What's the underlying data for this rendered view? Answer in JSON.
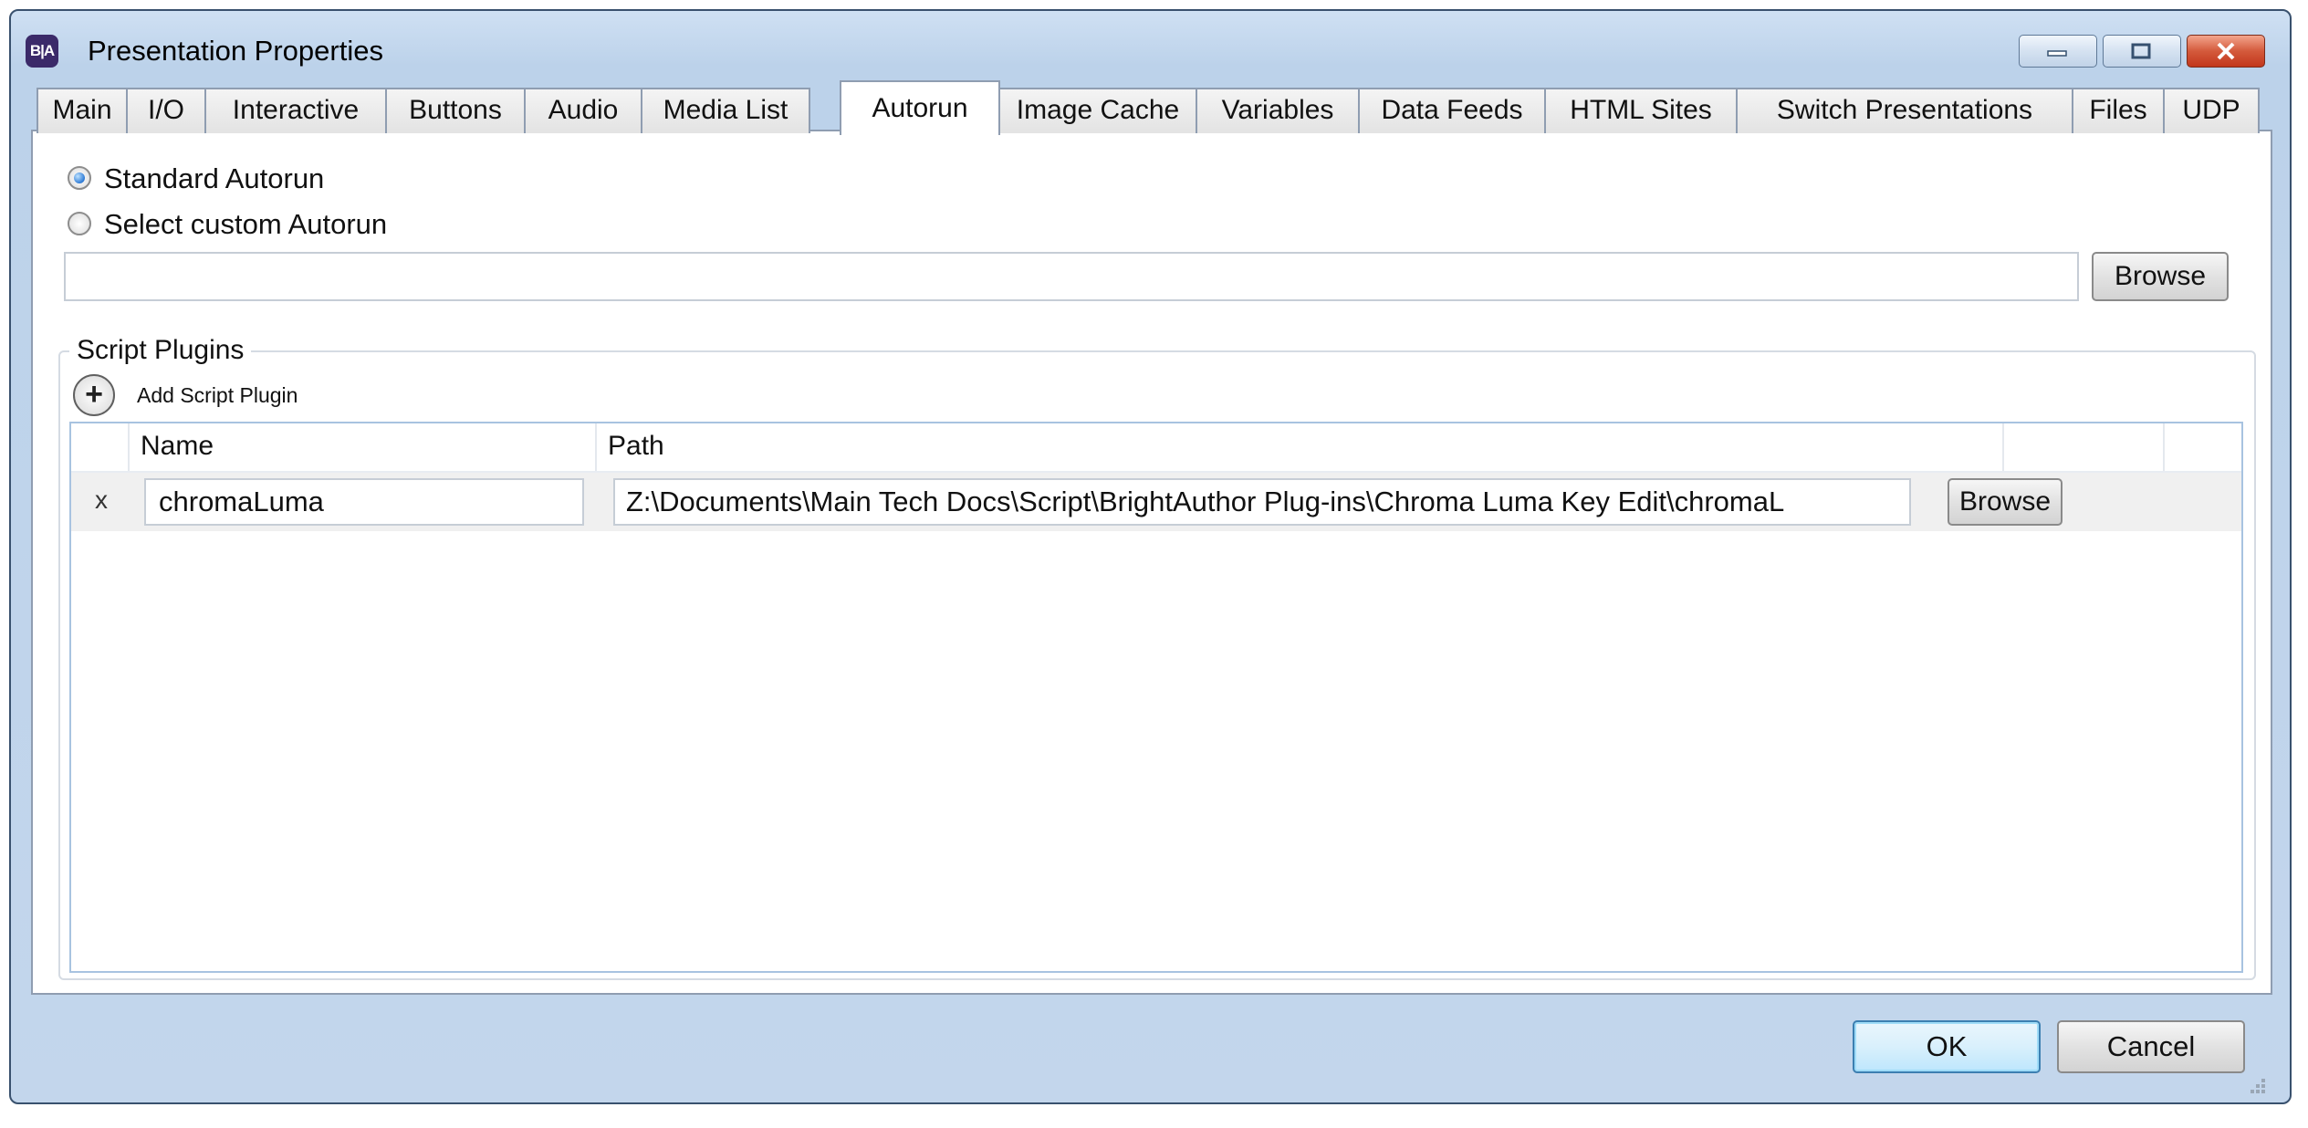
{
  "window": {
    "title": "Presentation Properties",
    "app_icon_text": "B|A"
  },
  "tabs": [
    {
      "label": "Main"
    },
    {
      "label": "I/O"
    },
    {
      "label": "Interactive"
    },
    {
      "label": "Buttons"
    },
    {
      "label": "Audio"
    },
    {
      "label": "Media List"
    },
    {
      "label": "Autorun",
      "selected": true
    },
    {
      "label": "Image Cache"
    },
    {
      "label": "Variables"
    },
    {
      "label": "Data Feeds"
    },
    {
      "label": "HTML Sites"
    },
    {
      "label": "Switch Presentations"
    },
    {
      "label": "Files"
    },
    {
      "label": "UDP"
    }
  ],
  "autorun": {
    "standard_label": "Standard Autorun",
    "standard_selected": true,
    "custom_label": "Select custom Autorun",
    "custom_selected": false,
    "custom_path_value": "",
    "browse_label": "Browse"
  },
  "script_plugins": {
    "group_title": "Script Plugins",
    "add_label": "Add Script Plugin",
    "columns": [
      "Name",
      "Path"
    ],
    "rows": [
      {
        "delete_label": "x",
        "name": "chromaLuma",
        "path": "Z:\\Documents\\Main Tech Docs\\Script\\BrightAuthor Plug-ins\\Chroma Luma Key Edit\\chromaL",
        "browse_label": "Browse"
      }
    ]
  },
  "footer": {
    "ok_label": "OK",
    "cancel_label": "Cancel"
  },
  "colors": {
    "title_bar": "#c3d6ec",
    "selected_row": "#f0f0f0",
    "grid_border": "#a8c3e0",
    "close_button": "#c2371b"
  }
}
